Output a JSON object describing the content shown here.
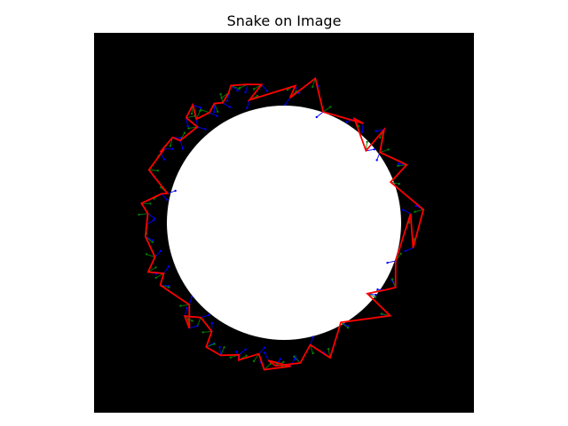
{
  "chart_data": {
    "type": "scatter",
    "title": "Snake on Image",
    "xlabel": "",
    "ylabel": "",
    "axes_visible": false,
    "grid": false,
    "background_color": "#000000",
    "image": {
      "shape": "circle",
      "fill_color": "#ffffff",
      "center": [
        300,
        300
      ],
      "radius": 185,
      "extent": [
        0,
        600,
        0,
        600
      ]
    },
    "snake": {
      "color": "#ff0000",
      "points": [
        [
          243.1,
          81.3
        ],
        [
          264.6,
          81.8
        ],
        [
          245.4,
          106.0
        ],
        [
          317.9,
          83.5
        ],
        [
          309.6,
          102.5
        ],
        [
          349.5,
          71.9
        ],
        [
          361.9,
          124.9
        ],
        [
          425.0,
          143.0
        ],
        [
          411.2,
          135.6
        ],
        [
          429.5,
          186.2
        ],
        [
          458.2,
          152.9
        ],
        [
          451.6,
          188.7
        ],
        [
          493.9,
          208.5
        ],
        [
          468.3,
          235.8
        ],
        [
          520.3,
          279.3
        ],
        [
          504.0,
          339.7
        ],
        [
          499.9,
          285.9
        ],
        [
          476.3,
          360.2
        ],
        [
          476.2,
          402.2
        ],
        [
          461.1,
          405.8
        ],
        [
          431.6,
          411.9
        ],
        [
          467.7,
          446.8
        ],
        [
          389.8,
          457.3
        ],
        [
          372.7,
          513.2
        ],
        [
          341.5,
          492.8
        ],
        [
          325.6,
          521.5
        ],
        [
          286.5,
          525.9
        ],
        [
          275.2,
          517.4
        ],
        [
          310.4,
          526.7
        ],
        [
          268.8,
          532.0
        ],
        [
          260.2,
          507.0
        ],
        [
          228.5,
          516.8
        ],
        [
          229.1,
          508.4
        ],
        [
          199.9,
          509.5
        ],
        [
          177.0,
          496.2
        ],
        [
          185.9,
          471.6
        ],
        [
          168.6,
          449.6
        ],
        [
          143.3,
          447.4
        ],
        [
          150.4,
          466.7
        ],
        [
          150.4,
          429.4
        ],
        [
          104.7,
          398.7
        ],
        [
          110.1,
          380.1
        ],
        [
          85.4,
          377.8
        ],
        [
          96.2,
          354.1
        ],
        [
          81.1,
          321.9
        ],
        [
          83.0,
          303.1
        ],
        [
          84.9,
          285.5
        ],
        [
          74.9,
          269.3
        ],
        [
          106.2,
          254.3
        ],
        [
          115.9,
          253.6
        ],
        [
          86.7,
          216.6
        ],
        [
          110.7,
          183.5
        ],
        [
          104.5,
          188.3
        ],
        [
          124.1,
          165.1
        ],
        [
          135.9,
          170.2
        ],
        [
          163.2,
          148.6
        ],
        [
          145.5,
          134.2
        ],
        [
          155.9,
          113.8
        ],
        [
          161.6,
          136.2
        ],
        [
          182.2,
          125.9
        ],
        [
          190.0,
          111.6
        ],
        [
          203.1,
          110.5
        ],
        [
          212.8,
          94.5
        ],
        [
          216.1,
          83.2
        ]
      ]
    },
    "force_series": [
      {
        "color": "#0000ff",
        "scale": 10
      },
      {
        "color": "#008000",
        "scale": 10
      }
    ]
  }
}
